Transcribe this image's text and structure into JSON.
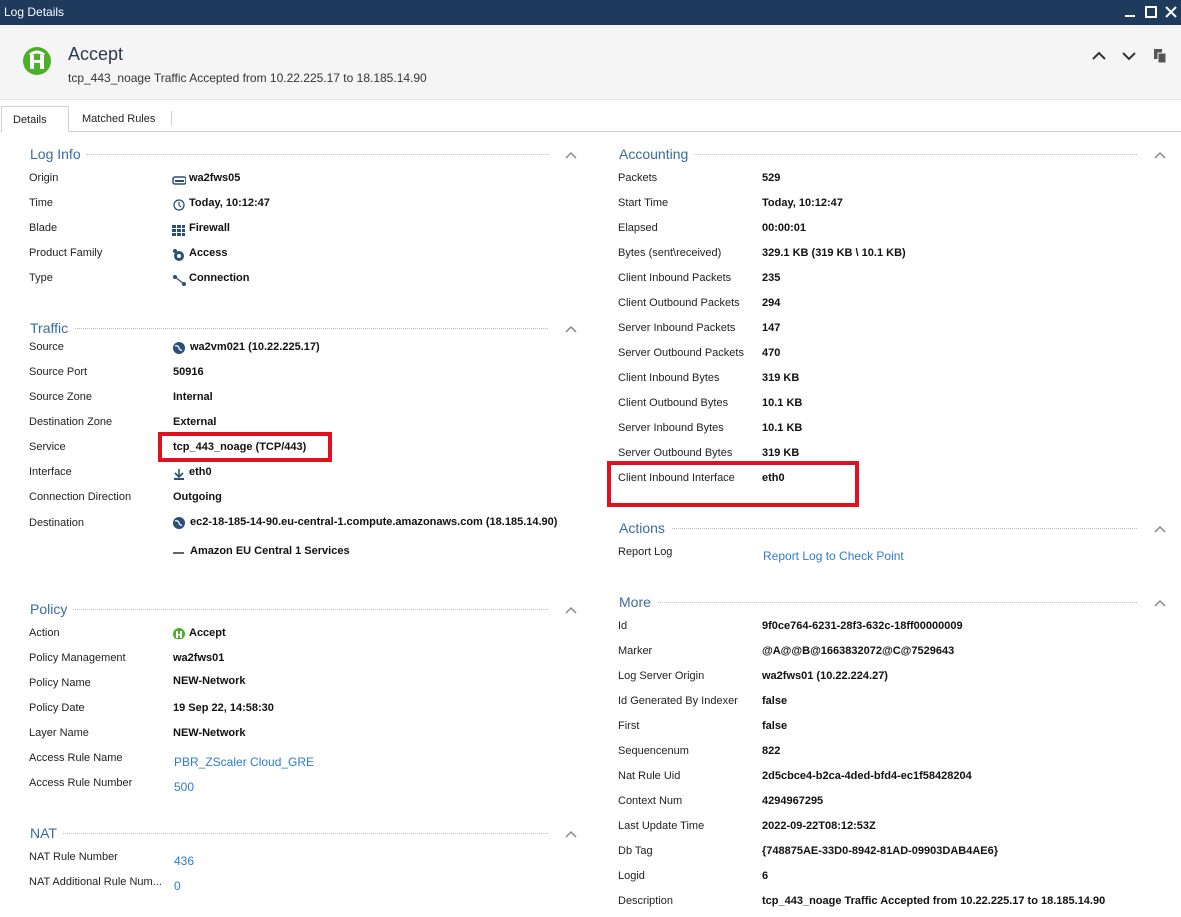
{
  "window": {
    "title": "Log Details"
  },
  "header": {
    "title": "Accept",
    "subtitle": "tcp_443_noage Traffic Accepted from 10.22.225.17 to 18.185.14.90"
  },
  "tabs": [
    {
      "label": "Details"
    },
    {
      "label": "Matched Rules"
    }
  ],
  "log_info": {
    "title": "Log Info",
    "rows": [
      {
        "label": "Origin",
        "value": "wa2fws05"
      },
      {
        "label": "Time",
        "value": "Today, 10:12:47"
      },
      {
        "label": "Blade",
        "value": "Firewall"
      },
      {
        "label": "Product Family",
        "value": "Access"
      },
      {
        "label": "Type",
        "value": "Connection"
      }
    ]
  },
  "traffic": {
    "title": "Traffic",
    "rows": [
      {
        "label": "Source",
        "value": "wa2vm021 (10.22.225.17)"
      },
      {
        "label": "Source Port",
        "value": "50916"
      },
      {
        "label": "Source Zone",
        "value": "Internal"
      },
      {
        "label": "Destination Zone",
        "value": "External"
      },
      {
        "label": "Service",
        "value": "tcp_443_noage (TCP/443)"
      },
      {
        "label": "Interface",
        "value": "eth0"
      },
      {
        "label": "Connection Direction",
        "value": "Outgoing"
      },
      {
        "label": "Destination",
        "value": "ec2-18-185-14-90.eu-central-1.compute.amazonaws.com (18.185.14.90)"
      }
    ],
    "destination_extra": "Amazon EU Central 1 Services"
  },
  "policy": {
    "title": "Policy",
    "rows": [
      {
        "label": "Action",
        "value": "Accept"
      },
      {
        "label": "Policy Management",
        "value": "wa2fws01"
      },
      {
        "label": "Policy Name",
        "value": "NEW-Network"
      },
      {
        "label": "Policy Date",
        "value": "19 Sep 22, 14:58:30"
      },
      {
        "label": "Layer Name",
        "value": "NEW-Network"
      },
      {
        "label": "Access Rule Name",
        "value": "PBR_ZScaler Cloud_GRE"
      },
      {
        "label": "Access Rule Number",
        "value": "500"
      }
    ]
  },
  "nat": {
    "title": "NAT",
    "rows": [
      {
        "label": "NAT Rule Number",
        "value": "436"
      },
      {
        "label": "NAT Additional Rule Num...",
        "value": "0"
      }
    ]
  },
  "accounting": {
    "title": "Accounting",
    "rows": [
      {
        "label": "Packets",
        "value": "529"
      },
      {
        "label": "Start Time",
        "value": "Today, 10:12:47"
      },
      {
        "label": "Elapsed",
        "value": "00:00:01"
      },
      {
        "label": "Bytes (sent\\received)",
        "value": "329.1 KB (319 KB \\ 10.1 KB)"
      },
      {
        "label": "Client Inbound Packets",
        "value": "235"
      },
      {
        "label": "Client Outbound Packets",
        "value": "294"
      },
      {
        "label": "Server Inbound Packets",
        "value": "147"
      },
      {
        "label": "Server Outbound Packets",
        "value": "470"
      },
      {
        "label": "Client Inbound Bytes",
        "value": "319 KB"
      },
      {
        "label": "Client Outbound Bytes",
        "value": "10.1 KB"
      },
      {
        "label": "Server Inbound Bytes",
        "value": "10.1 KB"
      },
      {
        "label": "Server Outbound Bytes",
        "value": "319 KB"
      },
      {
        "label": "Client Inbound Interface",
        "value": "eth0"
      }
    ]
  },
  "actions": {
    "title": "Actions",
    "rows": [
      {
        "label": "Report Log",
        "value": "Report Log to Check Point"
      }
    ]
  },
  "more": {
    "title": "More",
    "rows": [
      {
        "label": "Id",
        "value": "9f0ce764-6231-28f3-632c-18ff00000009"
      },
      {
        "label": "Marker",
        "value": "@A@@B@1663832072@C@7529643"
      },
      {
        "label": "Log Server Origin",
        "value": "wa2fws01 (10.22.224.27)"
      },
      {
        "label": "Id Generated By Indexer",
        "value": "false"
      },
      {
        "label": "First",
        "value": "false"
      },
      {
        "label": "Sequencenum",
        "value": "822"
      },
      {
        "label": "Nat Rule Uid",
        "value": "2d5cbce4-b2ca-4ded-bfd4-ec1f58428204"
      },
      {
        "label": "Context Num",
        "value": "4294967295"
      },
      {
        "label": "Last Update Time",
        "value": "2022-09-22T08:12:53Z"
      },
      {
        "label": "Db Tag",
        "value": "{748875AE-33D0-8942-81AD-09903DAB4AE6}"
      },
      {
        "label": "Logid",
        "value": "6"
      },
      {
        "label": "Description",
        "value": "tcp_443_noage Traffic Accepted from 10.22.225.17 to 18.185.14.90"
      }
    ]
  },
  "colors": {
    "titlebar": "#1e3a5c",
    "section_title": "#3b6aa0",
    "link": "#2f7ad1",
    "accept_green": "#4caf2a",
    "highlight_red": "#e0101e"
  },
  "icons": {
    "origin": "gateway-icon",
    "time": "clock-icon",
    "blade": "firewall-icon",
    "product_family": "access-icon",
    "type": "connection-icon",
    "source": "globe-icon",
    "interface": "download-arrow-icon",
    "destination": "globe-icon",
    "destination_extra": "dash-icon",
    "action": "accept-icon"
  }
}
